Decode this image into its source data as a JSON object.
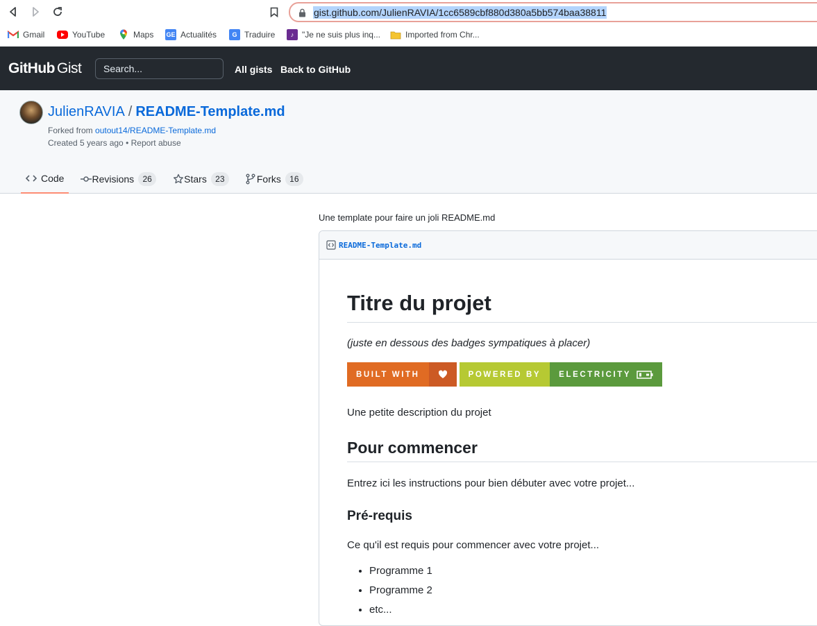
{
  "browser": {
    "url": "gist.github.com/JulienRAVIA/1cc6589cbf880d380a5bb574baa38811",
    "bookmarks": [
      {
        "label": "Gmail",
        "icon": "gmail-icon"
      },
      {
        "label": "YouTube",
        "icon": "youtube-icon"
      },
      {
        "label": "Maps",
        "icon": "maps-icon"
      },
      {
        "label": "Actualités",
        "icon": "news-icon"
      },
      {
        "label": "Traduire",
        "icon": "translate-icon"
      },
      {
        "label": "\"Je ne suis plus inq...",
        "icon": "bookmark-site-icon"
      },
      {
        "label": "Imported from Chr...",
        "icon": "folder-icon"
      }
    ]
  },
  "header": {
    "logo_main": "GitHub",
    "logo_sub": "Gist",
    "search_placeholder": "Search...",
    "nav": {
      "all_gists": "All gists",
      "back": "Back to GitHub"
    }
  },
  "gist": {
    "owner": "JulienRAVIA",
    "separator": "/",
    "name": "README-Template.md",
    "forked_prefix": "Forked from ",
    "forked_link": "outout14/README-Template.md",
    "created": "Created 5 years ago",
    "bullet": " • ",
    "report": "Report abuse",
    "tabs": [
      {
        "label": "Code",
        "count": ""
      },
      {
        "label": "Revisions",
        "count": "26"
      },
      {
        "label": "Stars",
        "count": "23"
      },
      {
        "label": "Forks",
        "count": "16"
      }
    ]
  },
  "content": {
    "description": "Une template pour faire un joli README.md",
    "file_name": "README-Template.md",
    "h1": "Titre du projet",
    "italic": "(juste en dessous des badges sympatiques à placer)",
    "badges": {
      "built_left": "BUILT WITH",
      "powered_left": "POWERED BY",
      "powered_right": "ELECTRICITY"
    },
    "desc_para": "Une petite description du projet",
    "h2": "Pour commencer",
    "h2_para": "Entrez ici les instructions pour bien débuter avec votre projet...",
    "h3": "Pré-requis",
    "h3_para": "Ce qu'il est requis pour commencer avec votre projet...",
    "list": [
      "Programme 1",
      "Programme 2",
      "etc..."
    ]
  },
  "colors": {
    "header_bg": "#24292f",
    "link": "#0969da",
    "badge_built_left": "#e06b23",
    "badge_built_right": "#cc5a24",
    "badge_powered_left": "#b6c933",
    "badge_powered_right": "#5b9a3d"
  }
}
